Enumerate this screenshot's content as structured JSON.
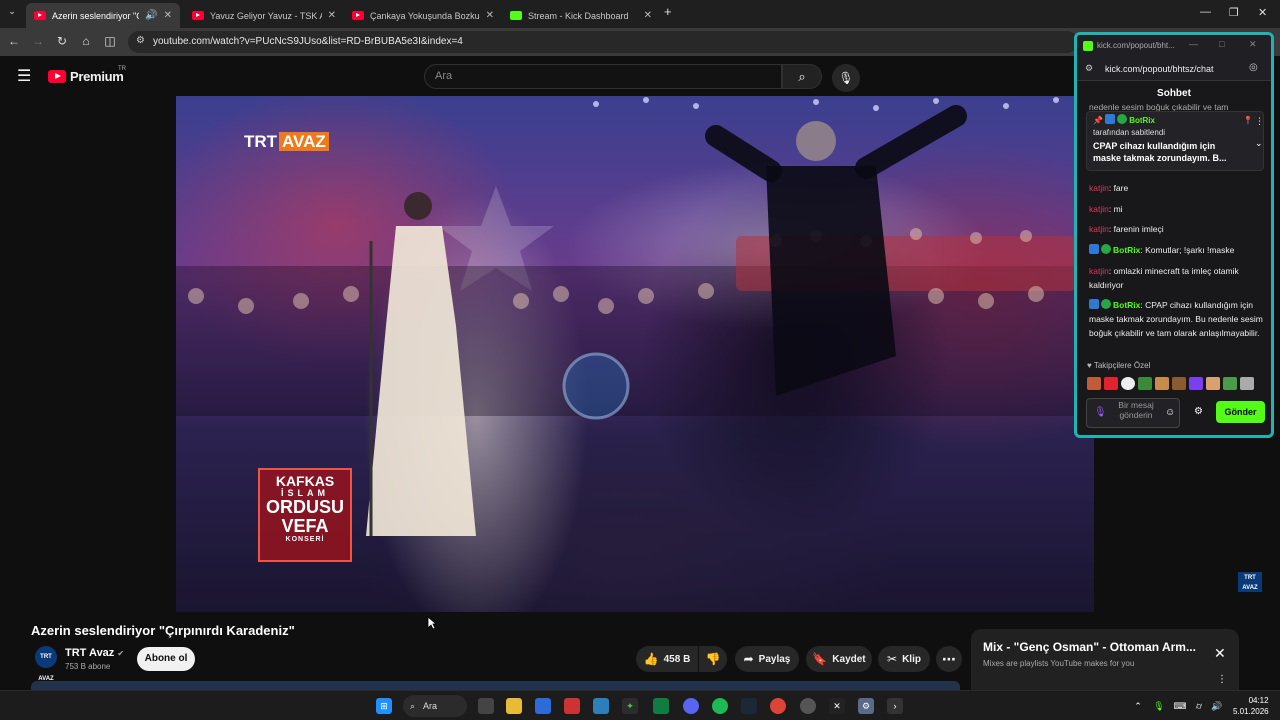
{
  "browser": {
    "tabs": [
      {
        "title": "Azerin seslendiriyor \"Çırpın",
        "favicon": "youtube-icon",
        "active": true
      },
      {
        "title": "Yavuz Geliyor Yavuz - TSK Armo",
        "favicon": "youtube-icon",
        "active": false
      },
      {
        "title": "Çankaya Yokuşunda Bozkurtlar",
        "favicon": "youtube-icon",
        "active": false
      },
      {
        "title": "Stream - Kick Dashboard",
        "favicon": "kick-icon",
        "active": false
      }
    ],
    "new_tab": "+",
    "url": "youtube.com/watch?v=PUcNcS9JUso&list=RD-BrBUBA5e3I&index=4"
  },
  "youtube": {
    "logo_text": "Premium",
    "logo_region": "TR",
    "search_placeholder": "Ara",
    "video": {
      "channel_bug": "TRT",
      "channel_bug_accent": "AVAZ",
      "overlay_lines": [
        "KAFKAS",
        "İSLAM",
        "ORDUSU",
        "VEFA",
        "KONSERİ"
      ],
      "corner_logo": "TRT AVAZ"
    },
    "title": "Azerin seslendiriyor \"Çırpınırdı Karadeniz\"",
    "channel": {
      "name": "TRT Avaz",
      "avatar_text": "TRT AVAZ",
      "subscribers": "753 B abone",
      "verified": true
    },
    "subscribe_label": "Abone ol",
    "actions": {
      "likes": "458 B",
      "share": "Paylaş",
      "save": "Kaydet",
      "clip": "Klip"
    },
    "mix": {
      "title": "Mix - \"Genç Osman\" - Ottoman Arm...",
      "subtitle": "Mixes are playlists YouTube makes for you"
    }
  },
  "kick": {
    "window_title": "kick.com/popout/bht...",
    "url": "kick.com/popout/bhtsz/chat",
    "header": "Sohbet",
    "partial_line": "nedenle sesim boğuk çıkabilir ve tam",
    "pinned": {
      "user": "BotRix",
      "pinned_by": "tarafından sabitlendi",
      "text": "CPAP cihazı kullandığım için maske takmak zorundayım. B..."
    },
    "messages": [
      {
        "user": "katjin",
        "text": ": fare"
      },
      {
        "user": "katjin",
        "text": ": mi"
      },
      {
        "user": "katjin",
        "text": ": farenin imleçi"
      },
      {
        "user": "BotRix",
        "text": ": Komutlar; !şarkı !maske"
      },
      {
        "user": "katjin",
        "text": ": omlazki minecraft ta imleç otamik kaldıriyor"
      },
      {
        "user": "BotRix",
        "text": ": CPAP cihazı kullandığım için maske takmak zorundayım. Bu nedenle sesim boğuk çıkabilir ve tam olarak anlaşılmayabilir."
      }
    ],
    "followers_label": "Takipçilere Özel",
    "input_placeholder": "Bir mesaj gönderin",
    "send_label": "Gönder",
    "colors": {
      "accent": "#53fc18",
      "user_katjin": "#e0355a",
      "border": "#1fb3b3"
    }
  },
  "taskbar": {
    "search_label": "Ara",
    "time": "04:12",
    "date": "5.01.2026"
  }
}
